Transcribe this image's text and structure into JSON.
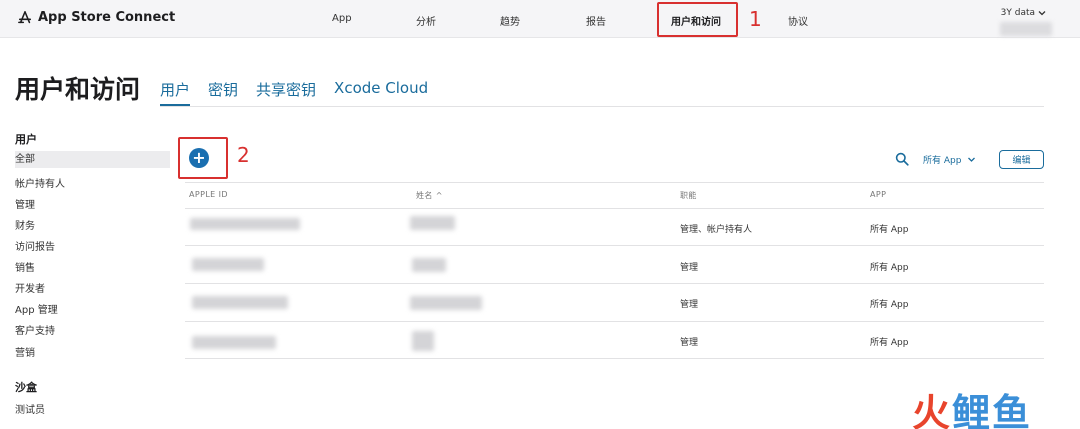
{
  "topbar": {
    "brand": "App Store Connect",
    "nav": [
      "App",
      "分析",
      "趋势",
      "报告",
      "用户和访问",
      "协议"
    ],
    "active_nav": "用户和访问",
    "account": "3Y data",
    "annotation_1": "1"
  },
  "page": {
    "title": "用户和访问",
    "tabs": [
      "用户",
      "密钥",
      "共享密钥",
      "Xcode Cloud"
    ],
    "active_tab": "用户"
  },
  "sidebar": {
    "users_heading": "用户",
    "users_items": [
      "全部",
      "帐户持有人",
      "管理",
      "财务",
      "访问报告",
      "销售",
      "开发者",
      "App 管理",
      "客户支持",
      "营销"
    ],
    "selected_item": "全部",
    "sandbox_heading": "沙盒",
    "sandbox_items": [
      "测试员"
    ]
  },
  "toolbar": {
    "add_symbol": "+",
    "annotation_2": "2",
    "filter_label": "所有 App",
    "edit_label": "编辑"
  },
  "table": {
    "headers": [
      "APPLE ID",
      "姓名 ^",
      "职能",
      "APP"
    ],
    "rows": [
      {
        "role": "管理、帐户持有人",
        "app": "所有 App"
      },
      {
        "role": "管理",
        "app": "所有 App"
      },
      {
        "role": "管理",
        "app": "所有 App"
      },
      {
        "role": "管理",
        "app": "所有 App"
      }
    ]
  },
  "watermark": {
    "fire": "火",
    "rest": "鲤鱼"
  },
  "colors": {
    "accent": "#1a6c9c",
    "add_button": "#1a6fb0",
    "annotation_red": "#d8302f"
  }
}
